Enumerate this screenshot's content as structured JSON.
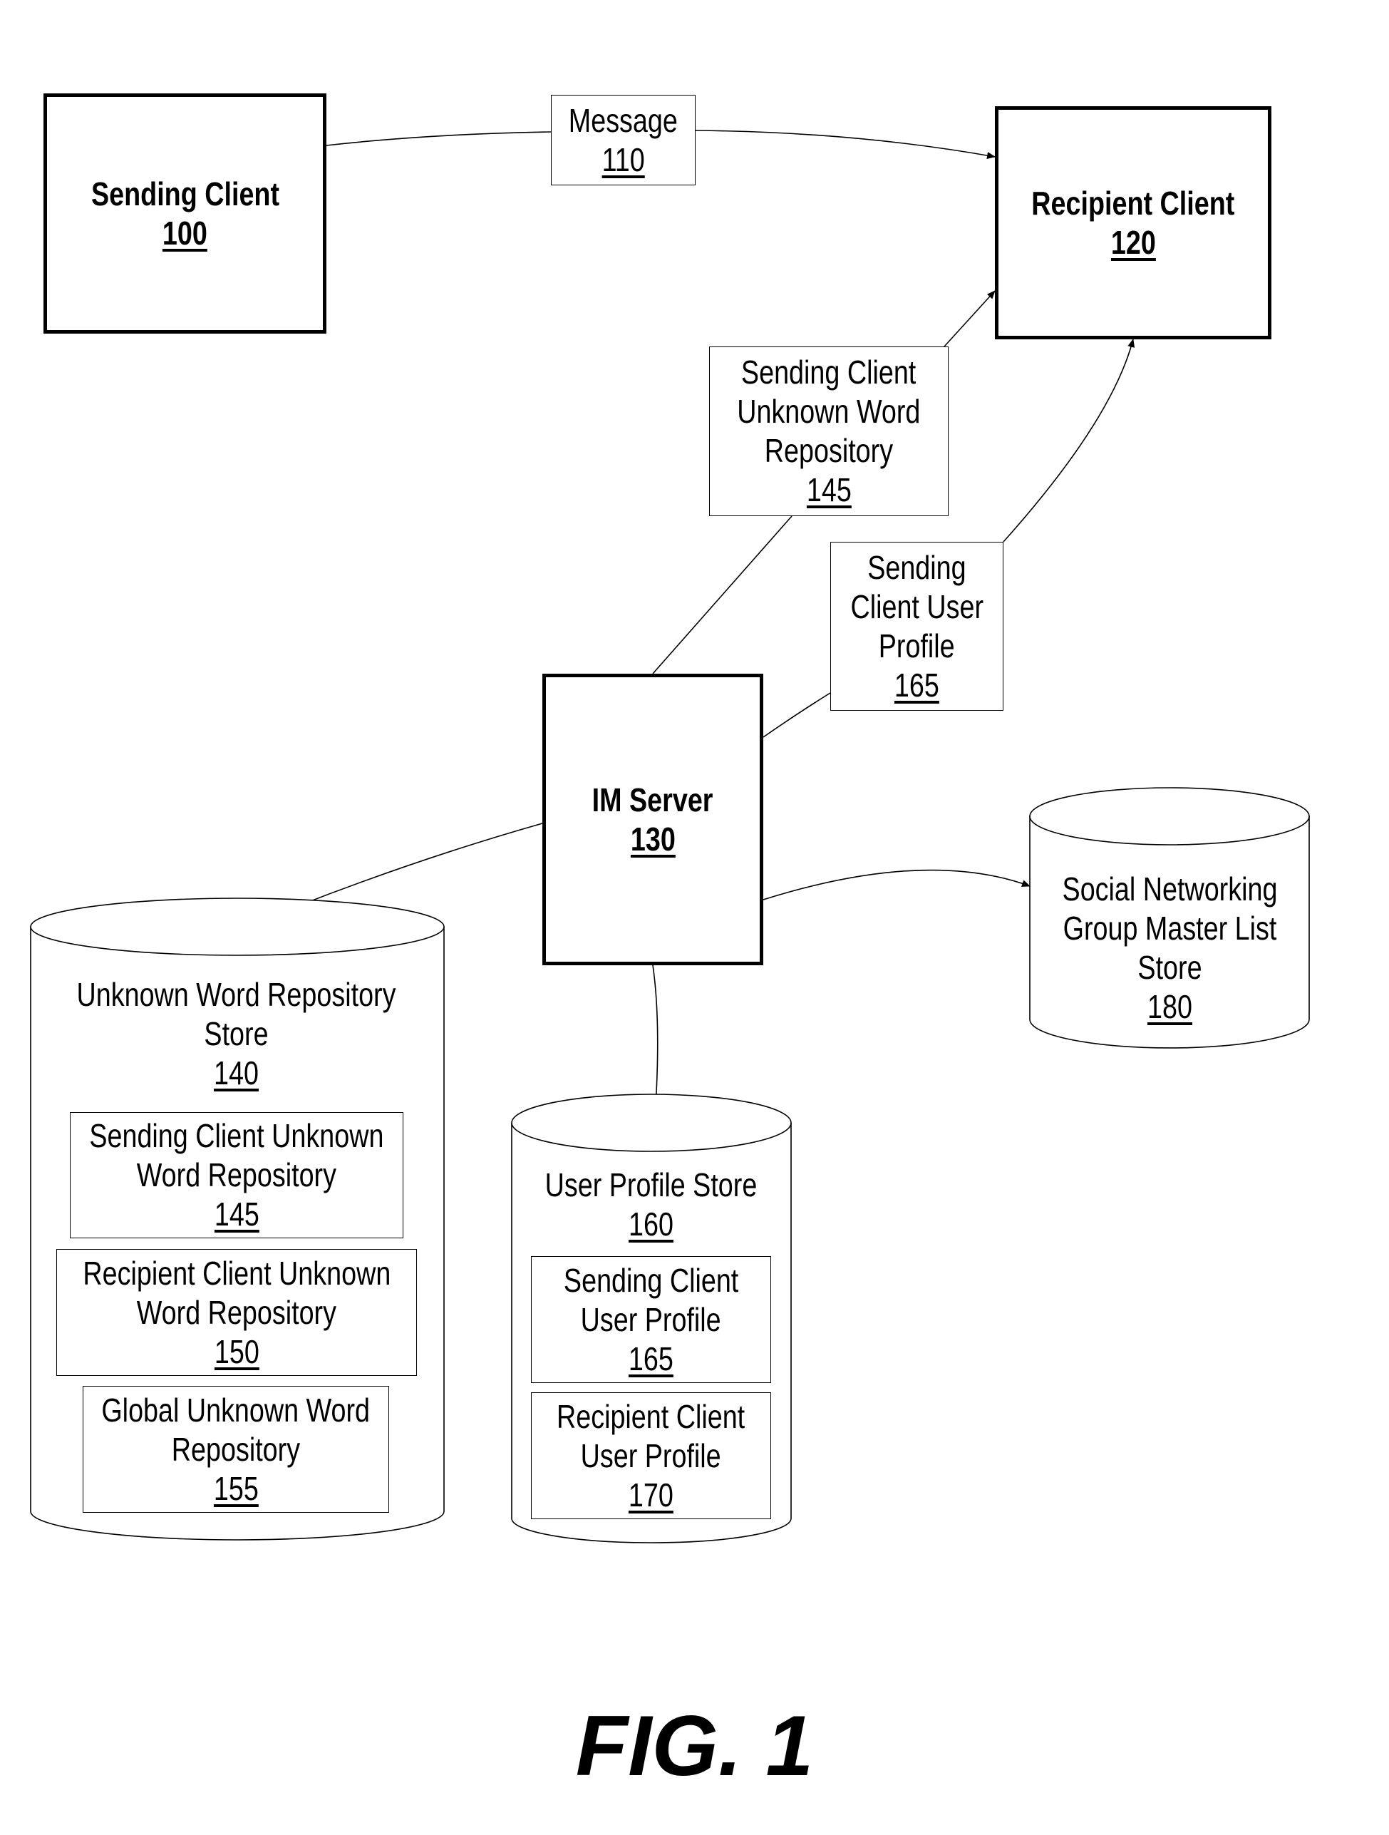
{
  "nodes": {
    "sending_client": {
      "title": "Sending Client",
      "ref": "100"
    },
    "message": {
      "title": "Message",
      "ref": "110"
    },
    "recipient_client": {
      "title": "Recipient Client",
      "ref": "120"
    },
    "im_server": {
      "title": "IM Server",
      "ref": "130"
    },
    "scuwr_transfer": {
      "lines": [
        "Sending Client",
        "Unknown Word",
        "Repository"
      ],
      "ref": "145"
    },
    "scup_transfer": {
      "lines": [
        "Sending",
        "Client User",
        "Profile"
      ],
      "ref": "165"
    },
    "unknown_word_store": {
      "lines": [
        "Unknown Word Repository",
        "Store"
      ],
      "ref": "140",
      "items": [
        {
          "lines": [
            "Sending Client Unknown",
            "Word Repository"
          ],
          "ref": "145"
        },
        {
          "lines": [
            "Recipient Client Unknown",
            "Word Repository"
          ],
          "ref": "150"
        },
        {
          "lines": [
            "Global Unknown Word",
            "Repository"
          ],
          "ref": "155"
        }
      ]
    },
    "user_profile_store": {
      "lines": [
        "User Profile Store"
      ],
      "ref": "160",
      "items": [
        {
          "lines": [
            "Sending Client",
            "User Profile"
          ],
          "ref": "165"
        },
        {
          "lines": [
            "Recipient Client",
            "User Profile"
          ],
          "ref": "170"
        }
      ]
    },
    "social_store": {
      "lines": [
        "Social Networking",
        "Group Master List",
        "Store"
      ],
      "ref": "180"
    }
  },
  "edges": [
    {
      "from": "sending_client",
      "to": "recipient_client",
      "via": "message",
      "arrow": "end"
    },
    {
      "from": "im_server",
      "to": "recipient_client",
      "via": "scuwr_transfer",
      "arrow": "end"
    },
    {
      "from": "im_server",
      "to": "recipient_client",
      "via": "scup_transfer",
      "arrow": "end"
    },
    {
      "from": "im_server",
      "to": "unknown_word_store",
      "arrow": "both"
    },
    {
      "from": "im_server",
      "to": "user_profile_store",
      "arrow": "end"
    },
    {
      "from": "im_server",
      "to": "social_store",
      "arrow": "end"
    }
  ],
  "figure_label": "FIG. 1"
}
